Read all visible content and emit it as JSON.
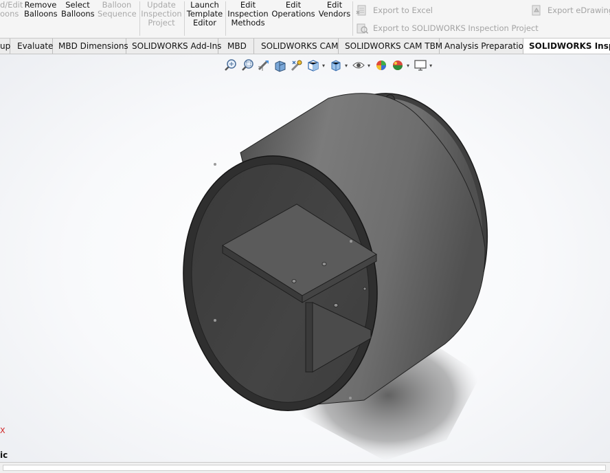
{
  "ribbon": {
    "buttons": [
      {
        "line1": "d/Edit",
        "line2": "oons",
        "line3": "",
        "enabled": false
      },
      {
        "line1": "Remove",
        "line2": "Balloons",
        "line3": "",
        "enabled": true
      },
      {
        "line1": "Select",
        "line2": "Balloons",
        "line3": "",
        "enabled": true
      },
      {
        "line1": "Balloon",
        "line2": "Sequence",
        "line3": "",
        "enabled": false
      },
      {
        "line1": "Update",
        "line2": "Inspection",
        "line3": "Project",
        "enabled": false
      },
      {
        "line1": "Launch",
        "line2": "Template",
        "line3": "Editor",
        "enabled": true
      },
      {
        "line1": "Edit",
        "line2": "Inspection",
        "line3": "Methods",
        "enabled": true
      },
      {
        "line1": "Edit",
        "line2": "Operations",
        "line3": "",
        "enabled": true
      },
      {
        "line1": "Edit",
        "line2": "Vendors",
        "line3": "",
        "enabled": true
      }
    ],
    "export_excel": "Export to Excel",
    "export_project": "Export to SOLIDWORKS Inspection Project",
    "export_edrawing": "Export eDrawing"
  },
  "tabs": [
    {
      "label": "up",
      "active": false
    },
    {
      "label": "Evaluate",
      "active": false
    },
    {
      "label": "MBD Dimensions",
      "active": false
    },
    {
      "label": "SOLIDWORKS Add-Ins",
      "active": false
    },
    {
      "label": "MBD",
      "active": false
    },
    {
      "label": "SOLIDWORKS CAM",
      "active": false
    },
    {
      "label": "SOLIDWORKS CAM TBM",
      "active": false
    },
    {
      "label": "Analysis Preparation",
      "active": false
    },
    {
      "label": "SOLIDWORKS Inspection",
      "active": true
    }
  ],
  "hud": {
    "icons": [
      "zoom-to-fit-icon",
      "zoom-to-area-icon",
      "previous-view-icon",
      "section-view-icon",
      "dynamic-annotation-icon",
      "view-orientation-icon",
      "display-style-icon",
      "hide-show-items-icon",
      "edit-appearance-icon",
      "apply-scene-icon",
      "view-settings-icon"
    ]
  },
  "viewport": {
    "triad_axis": "X",
    "view_name": "ic"
  },
  "colors": {
    "model_dark": "#3c3c3c",
    "model_mid": "#5e5e5e",
    "model_light": "#8a8a8a",
    "active_tab_bg": "#ffffff"
  }
}
